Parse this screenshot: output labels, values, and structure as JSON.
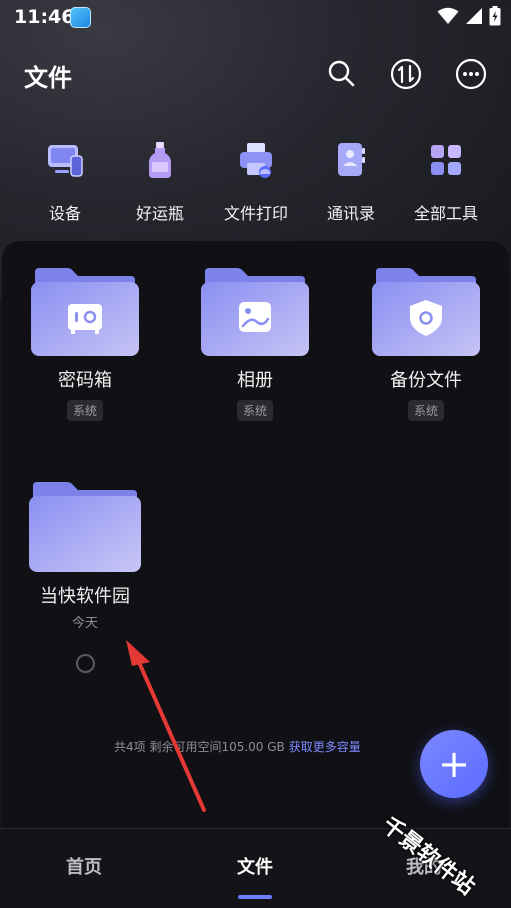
{
  "status": {
    "time": "11:46"
  },
  "header": {
    "title": "文件"
  },
  "tools": [
    {
      "label": "设备",
      "icon": "device-icon"
    },
    {
      "label": "好运瓶",
      "icon": "bottle-icon"
    },
    {
      "label": "文件打印",
      "icon": "printer-icon"
    },
    {
      "label": "通讯录",
      "icon": "contacts-icon"
    },
    {
      "label": "全部工具",
      "icon": "grid-icon"
    }
  ],
  "folders": [
    {
      "name": "密码箱",
      "tag": "系统",
      "icon": "safe-icon"
    },
    {
      "name": "相册",
      "tag": "系统",
      "icon": "photo-icon"
    },
    {
      "name": "备份文件",
      "tag": "系统",
      "icon": "shield-icon"
    },
    {
      "name": "当快软件园",
      "sub": "今天"
    }
  ],
  "storage": {
    "info": "共4项 剩余可用空间105.00 GB",
    "link": "获取更多容量"
  },
  "fab": {
    "label": "+"
  },
  "nav": [
    {
      "label": "首页"
    },
    {
      "label": "文件"
    },
    {
      "label": "我的"
    }
  ],
  "watermark": "千景软件站",
  "colors": {
    "accent": "#6f7dff",
    "folder": "#8f95f2",
    "arrow": "#e53935"
  }
}
